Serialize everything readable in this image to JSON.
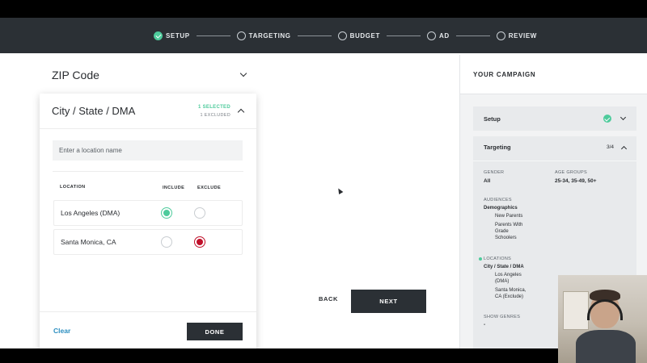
{
  "steps": [
    {
      "label": "SETUP",
      "status": "done"
    },
    {
      "label": "TARGETING",
      "status": "pending"
    },
    {
      "label": "BUDGET",
      "status": "pending"
    },
    {
      "label": "AD",
      "status": "pending"
    },
    {
      "label": "REVIEW",
      "status": "pending"
    }
  ],
  "zip": {
    "label": "ZIP Code"
  },
  "city_card": {
    "title": "City / State / DMA",
    "selected_count": "1 SELECTED",
    "excluded_count": "1 EXCLUDED",
    "search_placeholder": "Enter a location name",
    "columns": {
      "location": "LOCATION",
      "include": "INCLUDE",
      "exclude": "EXCLUDE"
    },
    "rows": [
      {
        "name": "Los Angeles (DMA)",
        "state": "include"
      },
      {
        "name": "Santa Monica, CA",
        "state": "exclude"
      }
    ],
    "clear_label": "Clear",
    "done_label": "DONE"
  },
  "nav": {
    "back_label": "BACK",
    "next_label": "NEXT"
  },
  "campaign": {
    "title": "YOUR CAMPAIGN",
    "setup": {
      "title": "Setup"
    },
    "targeting": {
      "title": "Targeting",
      "progress": "3/4",
      "gender_label": "GENDER",
      "gender_value": "All",
      "age_label": "AGE GROUPS",
      "age_value": "25-34, 35-49, 50+",
      "audiences_label": "AUDIENCES",
      "demographics_label": "Demographics",
      "demo_items": [
        "New Parents",
        "Parents With",
        "Grade",
        "Schoolers"
      ],
      "locations_label": "LOCATIONS",
      "loc_type": "City / State / DMA",
      "loc_items": [
        "Los Angeles",
        "(DMA)",
        "Santa Monica,",
        "CA (Exclude)"
      ],
      "genres_label": "SHOW GENRES",
      "genres_value": "-"
    }
  },
  "colors": {
    "accent_green": "#4ecb9c",
    "exclude_red": "#c0102a",
    "link_blue": "#2b8ec0",
    "dark": "#2b3035"
  }
}
